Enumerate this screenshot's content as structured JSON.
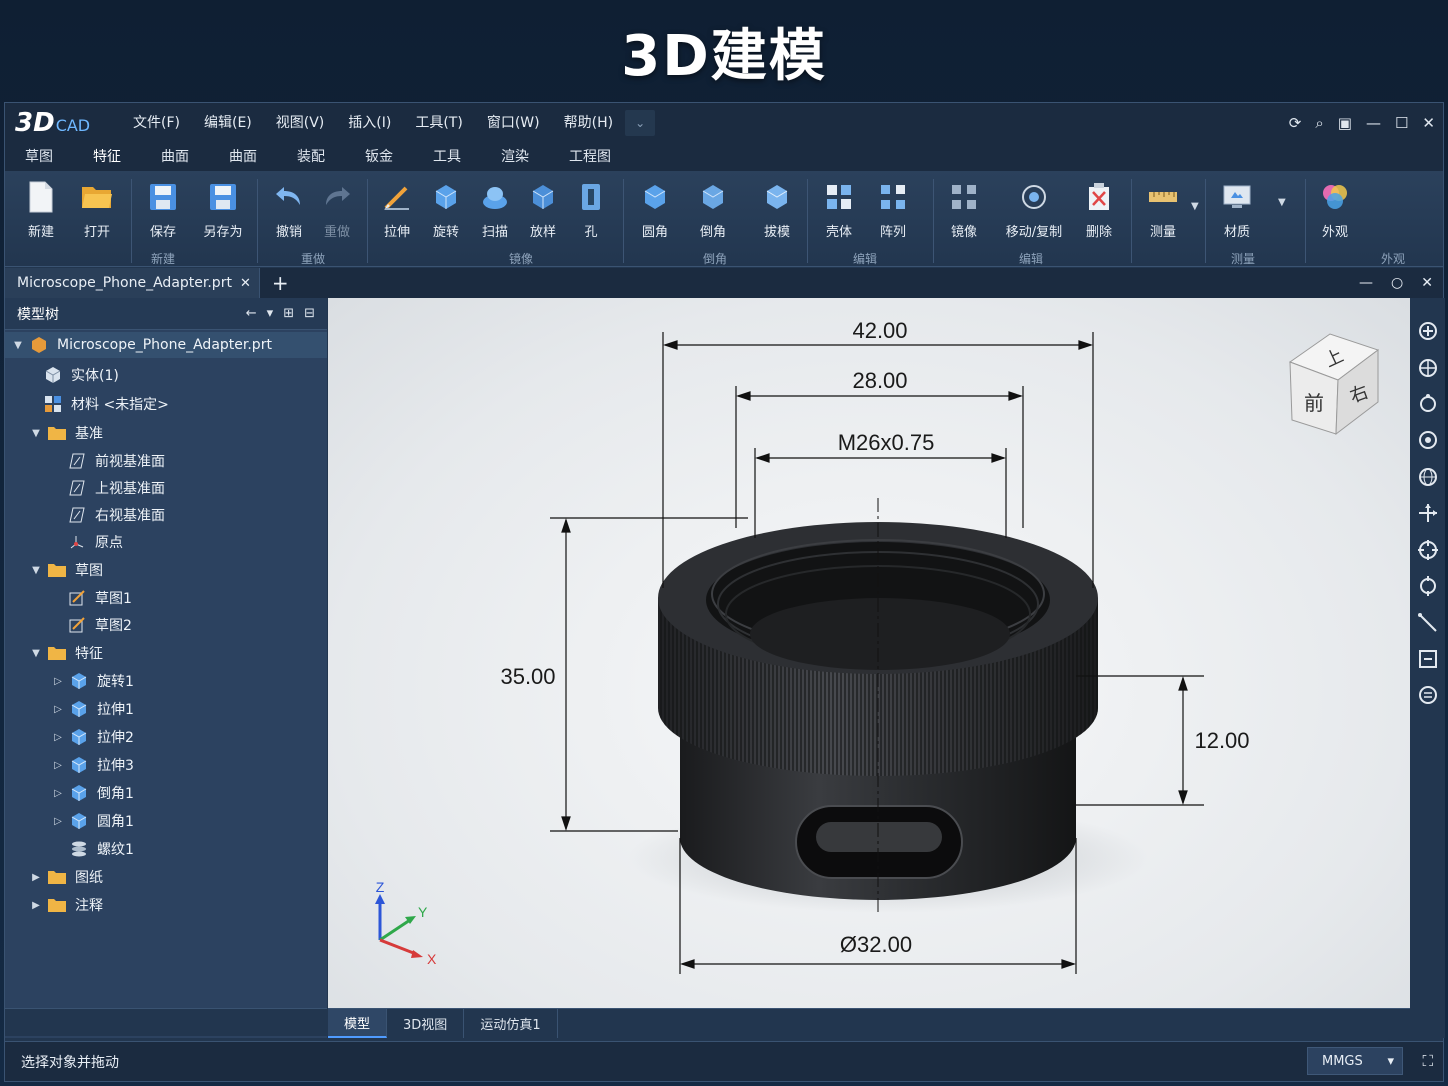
{
  "banner": {
    "title": "3D建模"
  },
  "app": {
    "logo_main": "3D",
    "logo_sub": "CAD"
  },
  "menu": [
    "文件(F)",
    "编辑(E)",
    "视图(V)",
    "插入(I)",
    "工具(T)",
    "窗口(W)",
    "帮助(H)"
  ],
  "ribbon_tabs": [
    "草图",
    "特征",
    "曲面",
    "曲面",
    "装配",
    "钣金",
    "工具",
    "渲染",
    "工程图"
  ],
  "ribbon_active_tab": "特征",
  "ribbon": {
    "buttons": [
      {
        "label": "新建",
        "icon": "new-file-icon"
      },
      {
        "label": "打开",
        "icon": "open-folder-icon"
      },
      {
        "label": "保存",
        "icon": "save-icon"
      },
      {
        "label": "另存为",
        "icon": "save-as-icon"
      },
      {
        "label": "撤销",
        "icon": "undo-icon"
      },
      {
        "label": "重做",
        "icon": "redo-icon"
      },
      {
        "label": "拉伸",
        "icon": "extrude-icon"
      },
      {
        "label": "旋转",
        "icon": "revolve-icon"
      },
      {
        "label": "扫描",
        "icon": "sweep-icon"
      },
      {
        "label": "放样",
        "icon": "loft-icon"
      },
      {
        "label": "孔",
        "icon": "hole-icon"
      },
      {
        "label": "圆角",
        "icon": "fillet-icon"
      },
      {
        "label": "倒角",
        "icon": "chamfer-icon"
      },
      {
        "label": "拔模",
        "icon": "draft-icon"
      },
      {
        "label": "壳体",
        "icon": "shell-icon"
      },
      {
        "label": "阵列",
        "icon": "pattern-icon"
      },
      {
        "label": "镜像",
        "icon": "mirror-icon"
      },
      {
        "label": "移动/复制",
        "icon": "move-copy-icon"
      },
      {
        "label": "删除",
        "icon": "delete-icon"
      },
      {
        "label": "测量",
        "icon": "measure-icon"
      },
      {
        "label": "材质",
        "icon": "material-icon"
      },
      {
        "label": "外观",
        "icon": "appearance-icon"
      }
    ],
    "groups": [
      "新建",
      "重做",
      "镜像",
      "倒角",
      "编辑",
      "编辑",
      "测量",
      "外观"
    ]
  },
  "document_tab": "Microscope_Phone_Adapter.prt",
  "model_tree": {
    "title": "模型树",
    "nodes": [
      {
        "label": "Microscope_Phone_Adapter.prt"
      },
      {
        "label": "实体(1)"
      },
      {
        "label": "材料 <未指定>"
      },
      {
        "label": "基准"
      },
      {
        "label": "前视基准面"
      },
      {
        "label": "上视基准面"
      },
      {
        "label": "右视基准面"
      },
      {
        "label": "原点"
      },
      {
        "label": "草图"
      },
      {
        "label": "草图1"
      },
      {
        "label": "草图2"
      },
      {
        "label": "特征"
      },
      {
        "label": "旋转1"
      },
      {
        "label": "拉伸1"
      },
      {
        "label": "拉伸2"
      },
      {
        "label": "拉伸3"
      },
      {
        "label": "倒角1"
      },
      {
        "label": "圆角1"
      },
      {
        "label": "螺纹1"
      },
      {
        "label": "图纸"
      },
      {
        "label": "注释"
      }
    ]
  },
  "dimensions": {
    "outer_width": "42.00",
    "thread_width": "28.00",
    "thread_spec": "M26x0.75",
    "height": "35.00",
    "base_height": "12.00",
    "base_diameter": "Ø32.00"
  },
  "view_cube": {
    "top": "上",
    "front": "前",
    "right": "右"
  },
  "triad": {
    "x": "X",
    "y": "Y",
    "z": "Z"
  },
  "bottom_tabs": [
    "模型",
    "3D视图",
    "运动仿真1"
  ],
  "status": {
    "message": "选择对象并拖动",
    "units": "MMGS"
  },
  "colors": {
    "accent": "#4f9bff",
    "panel": "#2c4260",
    "titlebar": "#1b2b40"
  }
}
